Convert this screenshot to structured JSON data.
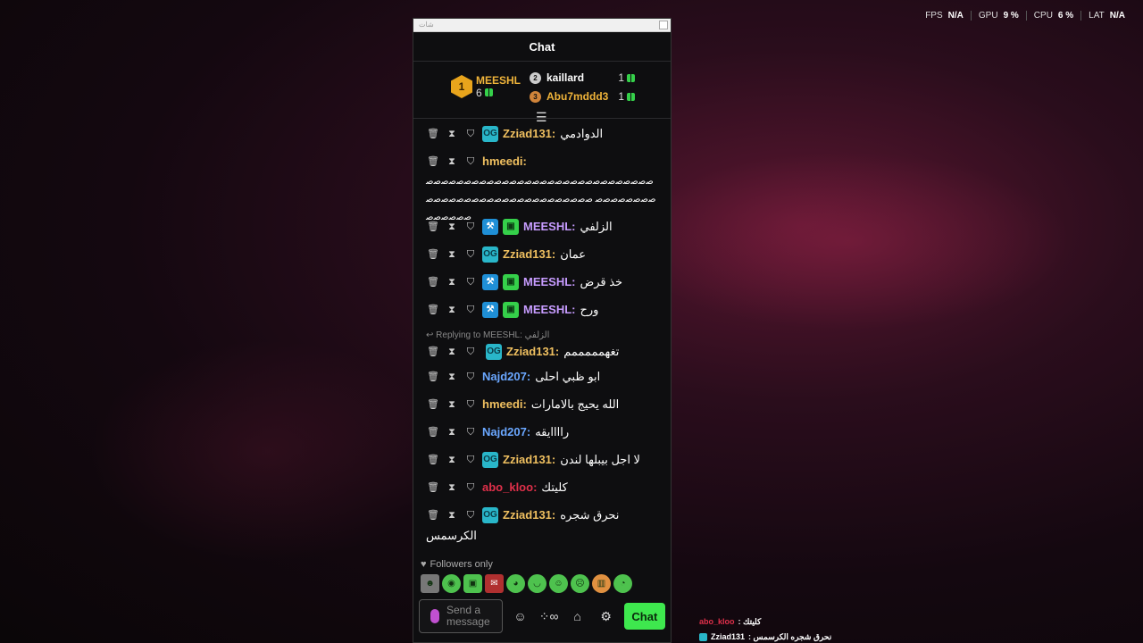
{
  "stats": [
    {
      "label": "FPS",
      "value": "N/A"
    },
    {
      "label": "GPU",
      "value": "9 %"
    },
    {
      "label": "CPU",
      "value": "6 %"
    },
    {
      "label": "LAT",
      "value": "N/A"
    }
  ],
  "window": {
    "titlebar": "شات",
    "title": "Chat"
  },
  "leaderboard": {
    "first": {
      "rank": "1",
      "name": "MEESHL",
      "count": "6"
    },
    "second": {
      "rank": "2",
      "name": "kaillard",
      "count": "1"
    },
    "third": {
      "rank": "3",
      "name": "Abu7mddd3",
      "count": "1"
    }
  },
  "messages": [
    {
      "user": "Zziad131:",
      "text": "الدوادمي"
    },
    {
      "user": "hmeedi:",
      "text": "ﺻﺻﺻﺻﺻﺻﺻﺻﺻﺻﺻﺻﺻﺻﺻﺻﺻﺻﺻﺻﺻﺻﺻﺻﺻﺻﺻﺻﺻﺻﺻﺻﺻﺻﺻﺻﺻﺻ ﺻﺻﺻﺻﺻﺻﺻﺻﺻﺻﺻﺻﺻﺻﺻﺻﺻﺻﺻﺻﺻﺻﺻﺻﺻﺻﺻﺻ"
    },
    {
      "user": "MEESHL:",
      "text": "الزلفي"
    },
    {
      "user": "Zziad131:",
      "text": "عمان"
    },
    {
      "user": "MEESHL:",
      "text": "خذ قرض"
    },
    {
      "user": "MEESHL:",
      "text": "ورح"
    },
    {
      "reply": "Replying to MEESHL: الزلفي",
      "user": "Zziad131:",
      "text": "تغهمممممم"
    },
    {
      "user": "Najd207:",
      "text": "ابو ظبي احلى"
    },
    {
      "user": "hmeedi:",
      "text": "الله يحيج بالامارات"
    },
    {
      "user": "Najd207:",
      "text": "راااايقه"
    },
    {
      "user": "Zziad131:",
      "text": "لا اجل بيبلها لندن"
    },
    {
      "user": "abo_kloo:",
      "text": "كليتك"
    },
    {
      "user": "Zziad131:",
      "text": "نحرق شجره",
      "text2": "الكرسمس"
    }
  ],
  "footer": {
    "followers": "Followers only",
    "placeholder": "Send a message",
    "chat_button": "Chat"
  },
  "overlay": {
    "line1_user": "abo_kloo",
    "line1_text": ": كليتك",
    "line2_user": "Zziad131",
    "line2_text": ": نحرق شجره الكرسمس"
  }
}
